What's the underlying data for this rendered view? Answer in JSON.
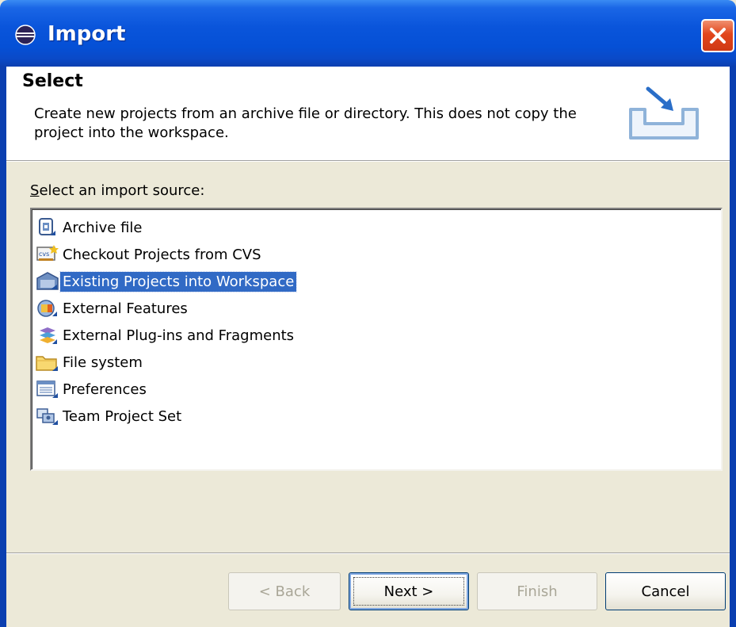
{
  "window": {
    "title": "Import",
    "icon": "eclipse-icon",
    "close_icon": "close-icon"
  },
  "header": {
    "title": "Select",
    "description": "Create new projects from an archive file or directory. This does not copy the project into the workspace.",
    "icon": "import-wizard-icon"
  },
  "source_label": {
    "mnemonic": "S",
    "rest": "elect an import source:"
  },
  "sources": [
    {
      "label": "Archive file",
      "icon": "archive-file-icon",
      "selected": false
    },
    {
      "label": "Checkout Projects from CVS",
      "icon": "cvs-icon",
      "selected": false
    },
    {
      "label": "Existing Projects into Workspace",
      "icon": "existing-projects-icon",
      "selected": true
    },
    {
      "label": "External Features",
      "icon": "external-features-icon",
      "selected": false
    },
    {
      "label": "External Plug-ins and Fragments",
      "icon": "plugins-icon",
      "selected": false
    },
    {
      "label": "File system",
      "icon": "folder-icon",
      "selected": false
    },
    {
      "label": "Preferences",
      "icon": "preferences-icon",
      "selected": false
    },
    {
      "label": "Team Project Set",
      "icon": "team-project-set-icon",
      "selected": false
    }
  ],
  "buttons": {
    "back": {
      "label": "< Back",
      "enabled": false
    },
    "next": {
      "label": "Next >",
      "enabled": true
    },
    "finish": {
      "label": "Finish",
      "enabled": false
    },
    "cancel": {
      "label": "Cancel",
      "enabled": true
    }
  },
  "colors": {
    "titlebar": "#0550d6",
    "selection": "#316ac5",
    "dialog_bg": "#ece9d8"
  }
}
